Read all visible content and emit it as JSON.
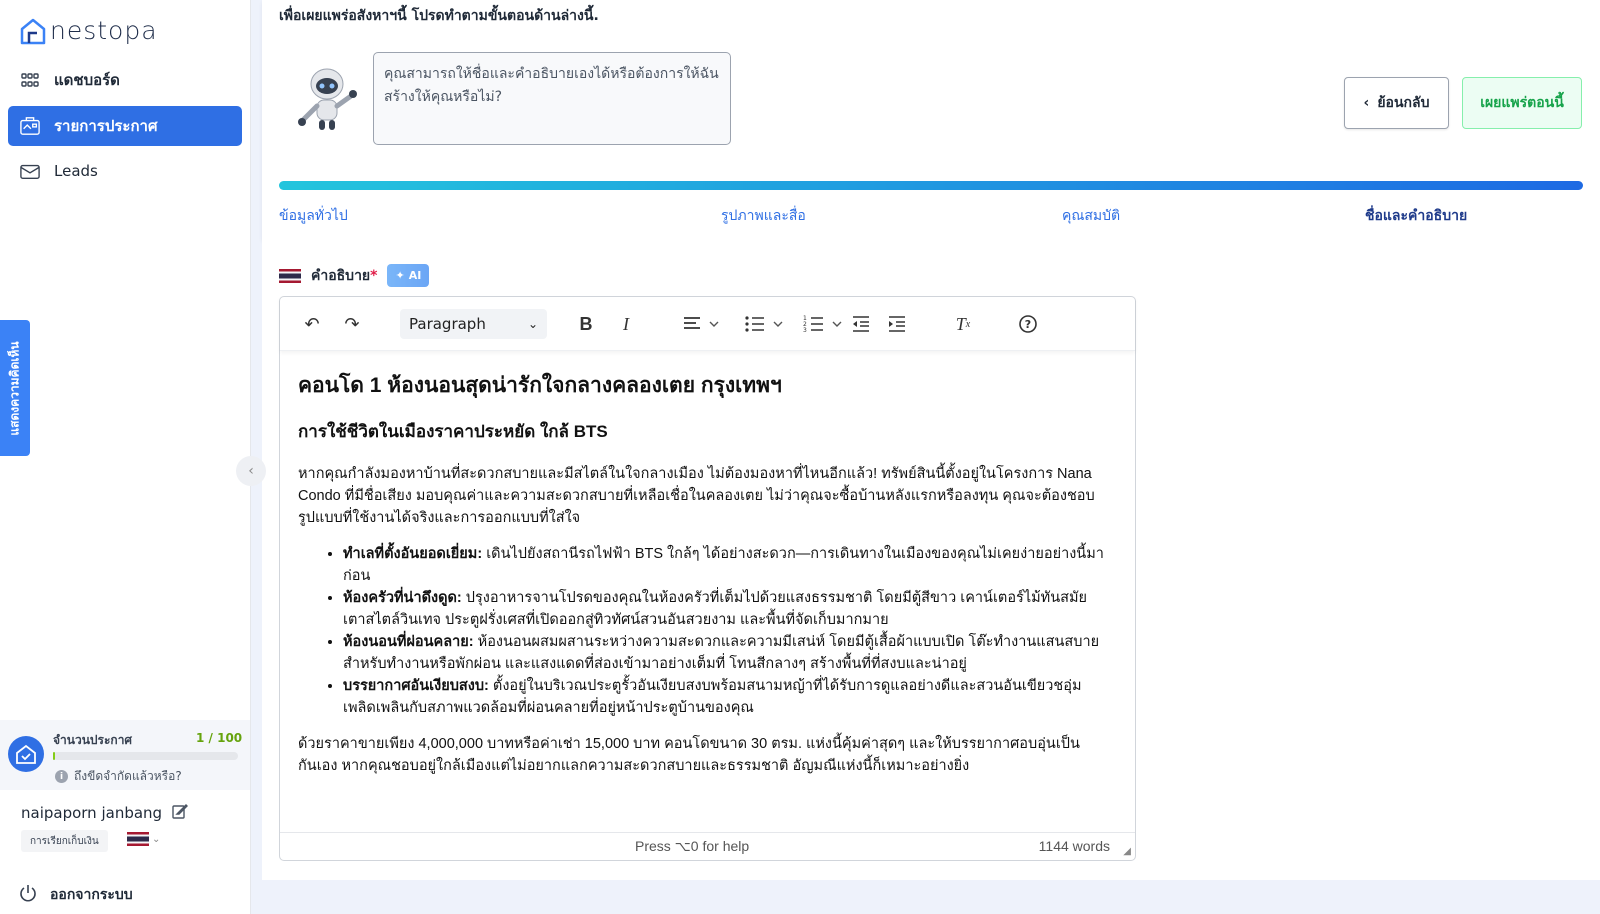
{
  "brand": {
    "name": "nestopa"
  },
  "sidebar": {
    "items": [
      {
        "label": "แดชบอร์ด",
        "icon": "grid-icon"
      },
      {
        "label": "รายการประกาศ",
        "icon": "listing-icon"
      },
      {
        "label": "Leads",
        "icon": "mail-icon"
      }
    ],
    "feedback_label": "แสดงความคิดเห็น",
    "quota": {
      "label": "จำนวนประกาศ",
      "count": "1 / 100",
      "used": 1,
      "total": 100,
      "help": "ถึงขีดจำกัดแล้วหรือ?"
    },
    "user": {
      "name": "naipaporn janbang",
      "billing": "การเรียกเก็บเงิน"
    },
    "logout_label": "ออกจากระบบ"
  },
  "header": {
    "intro": "เพื่อเผยแพร่อสังหาฯนี้ โปรดทำตามขั้นตอนด้านล่างนี้.",
    "assistant_message": "คุณสามารถให้ชื่อและคำอธิบายเองได้หรือต้องการให้ฉันสร้างให้คุณหรือไม่?",
    "back_label": "ย้อนกลับ",
    "publish_label": "เผยแพร่ตอนนี้"
  },
  "steps": [
    {
      "label": "ข้อมูลทั่วไป"
    },
    {
      "label": "รูปภาพและสื่อ"
    },
    {
      "label": "คุณสมบัติ"
    },
    {
      "label": "ชื่อและคำอธิบาย"
    }
  ],
  "description": {
    "label": "คำอธิบาย",
    "required_mark": "*",
    "ai_label": "AI"
  },
  "editor": {
    "paragraph_style": "Paragraph",
    "heading": "คอนโด 1 ห้องนอนสุดน่ารักใจกลางคลองเตย กรุงเทพฯ",
    "subheading": "การใช้ชีวิตในเมืองราคาประหยัด ใกล้ BTS",
    "intro": "หากคุณกำลังมองหาบ้านที่สะดวกสบายและมีสไตล์ในใจกลางเมือง ไม่ต้องมองหาที่ไหนอีกแล้ว! ทรัพย์สินนี้ตั้งอยู่ในโครงการ Nana Condo ที่มีชื่อเสียง มอบคุณค่าและความสะดวกสบายที่เหลือเชื่อในคลองเตย ไม่ว่าคุณจะซื้อบ้านหลังแรกหรือลงทุน คุณจะต้องชอบรูปแบบที่ใช้งานได้จริงและการออกแบบที่ใส่ใจ",
    "bullets": [
      {
        "title": "ทำเลที่ตั้งอันยอดเยี่ยม:",
        "text": " เดินไปยังสถานีรถไฟฟ้า BTS ใกล้ๆ ได้อย่างสะดวก—การเดินทางในเมืองของคุณไม่เคยง่ายอย่างนี้มาก่อน"
      },
      {
        "title": "ห้องครัวที่น่าดึงดูด:",
        "text": " ปรุงอาหารจานโปรดของคุณในห้องครัวที่เต็มไปด้วยแสงธรรมชาติ โดยมีตู้สีขาว เคาน์เตอร์ไม้ทันสมัย เตาสไตล์วินเทจ ประตูฝรั่งเศสที่เปิดออกสู่ทิวทัศน์สวนอันสวยงาม และพื้นที่จัดเก็บมากมาย"
      },
      {
        "title": "ห้องนอนที่ผ่อนคลาย:",
        "text": " ห้องนอนผสมผสานระหว่างความสะดวกและความมีเสน่ห์ โดยมีตู้เสื้อผ้าแบบเปิด โต๊ะทำงานแสนสบายสำหรับทำงานหรือพักผ่อน และแสงแดดที่ส่องเข้ามาอย่างเต็มที่ โทนสีกลางๆ สร้างพื้นที่ที่สงบและน่าอยู่"
      },
      {
        "title": "บรรยากาศอันเงียบสงบ:",
        "text": " ตั้งอยู่ในบริเวณประตูรั้วอันเงียบสงบพร้อมสนามหญ้าที่ได้รับการดูแลอย่างดีและสวนอันเขียวชอุ่ม เพลิดเพลินกับสภาพแวดล้อมที่ผ่อนคลายที่อยู่หน้าประตูบ้านของคุณ"
      }
    ],
    "closing": "ด้วยราคาขายเพียง 4,000,000 บาทหรือค่าเช่า 15,000 บาท คอนโดขนาด 30 ตรม. แห่งนี้คุ้มค่าสุดๆ และให้บรรยากาศอบอุ่นเป็นกันเอง หากคุณชอบอยู่ใกล้เมืองแต่ไม่อยากแลกความสะดวกสบายและธรรมชาติ อัญมณีแห่งนี้ก็เหมาะอย่างยิ่ง",
    "status_help": "Press ⌥0 for help",
    "word_count": "1144 words"
  },
  "colors": {
    "primary": "#2f6fe4",
    "publish": "#16a34a",
    "quota": "#84cc16"
  }
}
